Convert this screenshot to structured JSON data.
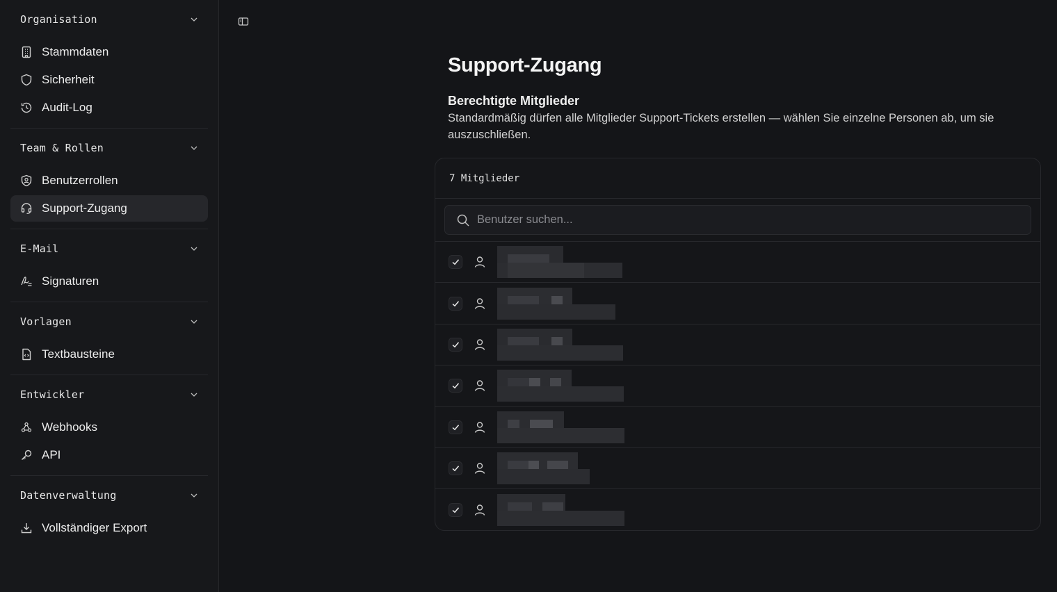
{
  "sidebar": {
    "sections": [
      {
        "title": "Organisation",
        "items": [
          {
            "label": "Stammdaten",
            "icon": "building-icon"
          },
          {
            "label": "Sicherheit",
            "icon": "shield-icon"
          },
          {
            "label": "Audit-Log",
            "icon": "history-icon"
          }
        ]
      },
      {
        "title": "Team & Rollen",
        "items": [
          {
            "label": "Benutzerrollen",
            "icon": "shield-user-icon"
          },
          {
            "label": "Support-Zugang",
            "icon": "headset-icon",
            "active": true
          }
        ]
      },
      {
        "title": "E-Mail",
        "items": [
          {
            "label": "Signaturen",
            "icon": "signature-icon"
          }
        ]
      },
      {
        "title": "Vorlagen",
        "items": [
          {
            "label": "Textbausteine",
            "icon": "file-code-icon"
          }
        ]
      },
      {
        "title": "Entwickler",
        "items": [
          {
            "label": "Webhooks",
            "icon": "webhook-icon"
          },
          {
            "label": "API",
            "icon": "key-icon"
          }
        ]
      },
      {
        "title": "Datenverwaltung",
        "items": [
          {
            "label": "Vollständiger Export",
            "icon": "download-icon"
          }
        ]
      }
    ]
  },
  "main": {
    "title": "Support-Zugang",
    "subtitle": "Berechtigte Mitglieder",
    "description": "Standardmäßig dürfen alle Mitglieder Support-Tickets erstellen — wählen Sie einzelne Personen ab, um sie auszuschließen.",
    "member_count": "7 Mitglieder",
    "search_placeholder": "Benutzer suchen...",
    "members": [
      {
        "checked": true
      },
      {
        "checked": true
      },
      {
        "checked": true
      },
      {
        "checked": true
      },
      {
        "checked": true
      },
      {
        "checked": true
      },
      {
        "checked": true
      }
    ]
  },
  "colors": {
    "background": "#141518",
    "sidebar": "#17181b",
    "active_item": "#26272b",
    "border": "#27282c"
  }
}
